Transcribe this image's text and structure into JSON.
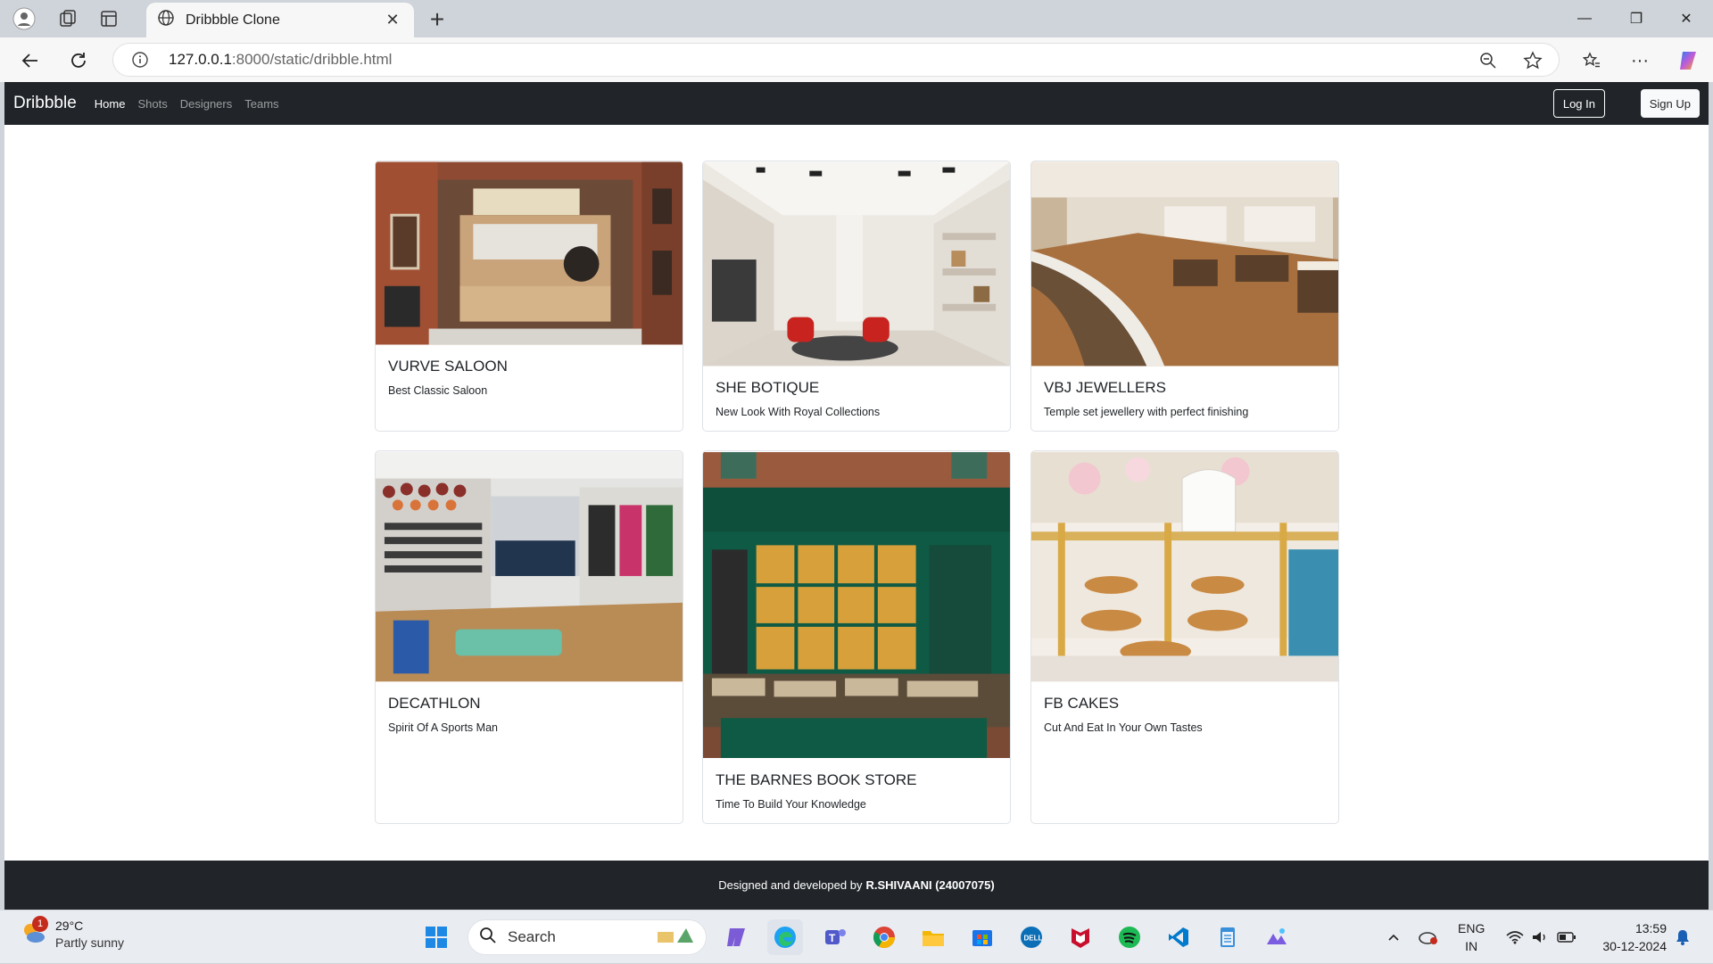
{
  "browser": {
    "tab_title": "Dribbble Clone",
    "url_host": "127.0.0.1",
    "url_path": ":8000/static/dribble.html"
  },
  "site": {
    "brand": "Dribbble",
    "nav": [
      "Home",
      "Shots",
      "Designers",
      "Teams"
    ],
    "login_label": "Log In",
    "signup_label": "Sign Up",
    "footer_prefix": "Designed and developed by",
    "footer_author": "R.SHIVAANI (24007075)"
  },
  "cards": [
    {
      "title": "VURVE SALOON",
      "text": "Best Classic Saloon",
      "image": "barbershop-storefront-image"
    },
    {
      "title": "SHE BOTIQUE",
      "text": "New Look With Royal Collections",
      "image": "boutique-interior-image"
    },
    {
      "title": "VBJ JEWELLERS",
      "text": "Temple set jewellery with perfect finishing",
      "image": "jewellery-showroom-image"
    },
    {
      "title": "DECATHLON",
      "text": "Spirit Of A Sports Man",
      "image": "sports-store-image"
    },
    {
      "title": "THE BARNES BOOK STORE",
      "text": "Time To Build Your Knowledge",
      "image": "bookstore-front-image"
    },
    {
      "title": "FB CAKES",
      "text": "Cut And Eat In Your Own Tastes",
      "image": "bakery-counter-image"
    }
  ],
  "taskbar": {
    "weather_temp": "29°C",
    "weather_desc": "Partly sunny",
    "weather_badge": "1",
    "search_label": "Search",
    "lang_top": "ENG",
    "lang_bottom": "IN",
    "time": "13:59",
    "date": "30-12-2024"
  },
  "colors": {
    "navbar": "#212529",
    "page_bg": "#ffffff",
    "card_border": "#dee2e6"
  }
}
